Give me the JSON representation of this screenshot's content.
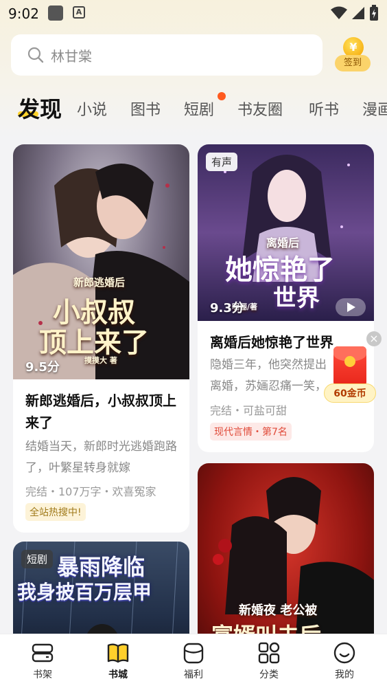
{
  "status_bar": {
    "time": "9:02"
  },
  "search": {
    "placeholder": "林甘棠"
  },
  "checkin": {
    "coin_symbol": "¥",
    "label": "签到"
  },
  "tabs": [
    {
      "label": "发现",
      "active": true
    },
    {
      "label": "小说"
    },
    {
      "label": "图书"
    },
    {
      "label": "短剧",
      "has_dot": true
    },
    {
      "label": "书友圈"
    },
    {
      "label": "听书"
    },
    {
      "label": "漫画"
    }
  ],
  "cards": {
    "card1": {
      "cover_line1": "新郎逃婚后",
      "cover_line2": "小叔叔",
      "cover_line3": "顶上来了",
      "cover_author": "摸摸大 著",
      "score": "9.5分",
      "title": "新郎逃婚后，小叔叔顶上来了",
      "desc": "结婚当天，新郎时光逃婚跑路了，叶繁星转身就嫁",
      "meta": "完结・107万字・欢喜冤家",
      "tag": "全站热搜中!"
    },
    "card2": {
      "badge": "有声",
      "cover_line1": "离婚后",
      "cover_line2": "她惊艳了",
      "cover_line3": "世界",
      "cover_author": "明俪/著",
      "score": "9.3分",
      "title": "离婚后她惊艳了世界",
      "desc": "隐婚三年，他突然提出离婚，苏婳忍痛一笑，",
      "meta": "完结・可盐可甜",
      "tag": "现代言情・第7名"
    },
    "card3": {
      "badge": "短剧",
      "cover_line1": "暴雨降临",
      "cover_line2": "我身披百万层甲"
    },
    "card4": {
      "cover_line1": "新婚夜 老公被",
      "cover_line2": "富婿叫去后"
    }
  },
  "red_packet": {
    "close": "×",
    "label": "60金币"
  },
  "bottom_nav": [
    {
      "label": "书架",
      "icon": "bookshelf-icon"
    },
    {
      "label": "书城",
      "icon": "bookstore-icon",
      "active": true
    },
    {
      "label": "福利",
      "icon": "welfare-icon"
    },
    {
      "label": "分类",
      "icon": "category-icon"
    },
    {
      "label": "我的",
      "icon": "profile-icon"
    }
  ],
  "colors": {
    "accent": "#ffd32b",
    "tag_red": "#e04b3a",
    "dot": "#ff5a1f"
  }
}
